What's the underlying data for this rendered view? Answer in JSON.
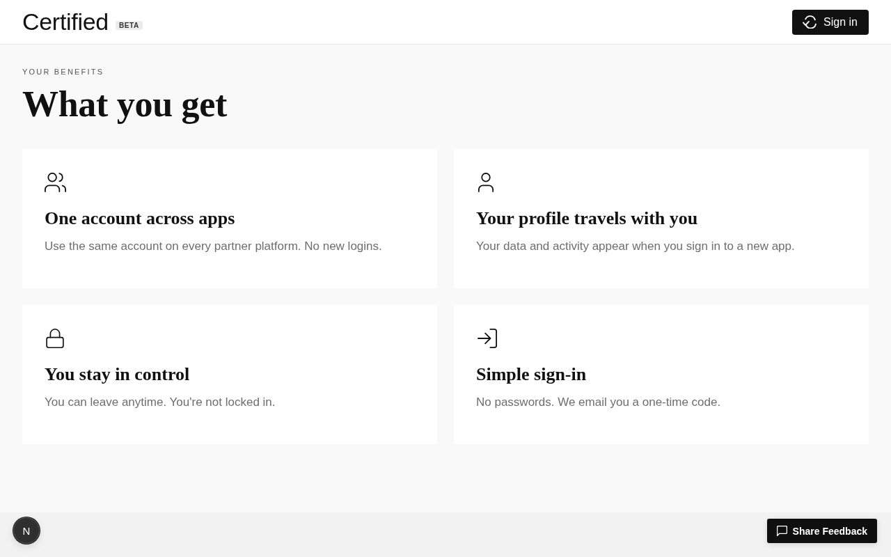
{
  "header": {
    "brand": "Certified",
    "badge": "BETA",
    "sign_in_button": "Sign in"
  },
  "eyebrow": "YOUR BENEFITS",
  "heading": "What you get",
  "benefits": [
    {
      "title": "One account across apps",
      "description": "Use the same account on every partner platform. No new logins."
    },
    {
      "title": "Your profile travels with you",
      "description": "Your data and activity appear when you sign in to a new app."
    },
    {
      "title": "You stay in control",
      "description": "You can leave anytime. You're not locked in."
    },
    {
      "title": "Simple sign-in",
      "description": "No passwords. We email you a one-time code."
    }
  ],
  "dev_tools_button": "N",
  "feedback_button": "Share Feedback"
}
